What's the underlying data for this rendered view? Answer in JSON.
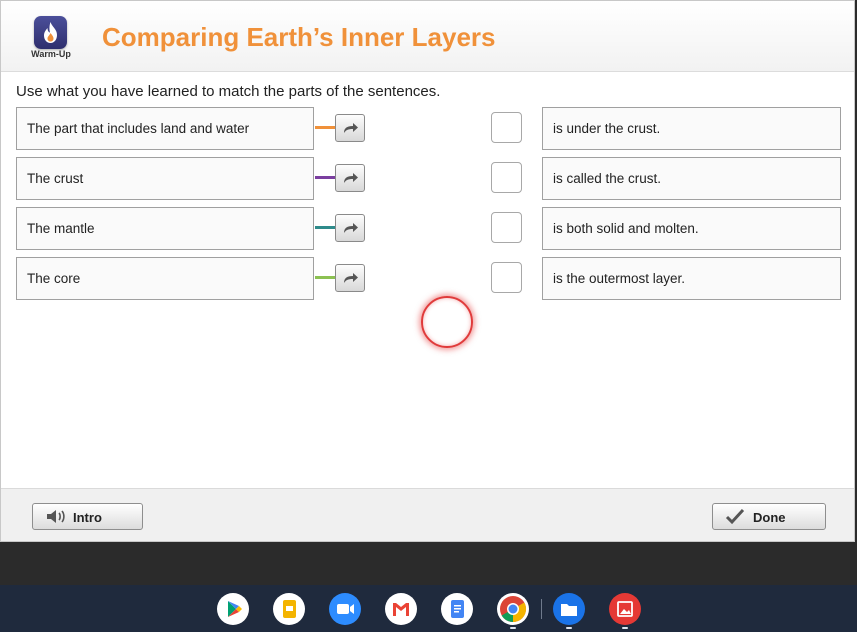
{
  "header": {
    "logo_label": "Warm-Up",
    "title": "Comparing Earth’s Inner Layers"
  },
  "instructions": "Use what you have learned to match the parts of the sentences.",
  "left_items": [
    {
      "text": "The part that includes land and water",
      "color": "#f0913a"
    },
    {
      "text": "The crust",
      "color": "#7b3fa0"
    },
    {
      "text": "The mantle",
      "color": "#2e8b8b"
    },
    {
      "text": "The core",
      "color": "#8cc152"
    }
  ],
  "right_items": [
    {
      "text": "is under the crust."
    },
    {
      "text": "is called the crust."
    },
    {
      "text": "is both solid and molten."
    },
    {
      "text": "is the outermost layer."
    }
  ],
  "footer": {
    "intro_label": "Intro",
    "done_label": "Done"
  },
  "taskbar": {
    "apps": [
      "play-store-icon",
      "slides-icon",
      "zoom-icon",
      "gmail-icon",
      "docs-icon",
      "chrome-icon",
      "files-icon",
      "gallery-icon"
    ]
  },
  "colors": {
    "accent": "#f0913a",
    "logo": "#3a3d85",
    "taskbar": "#1f2a3d"
  }
}
